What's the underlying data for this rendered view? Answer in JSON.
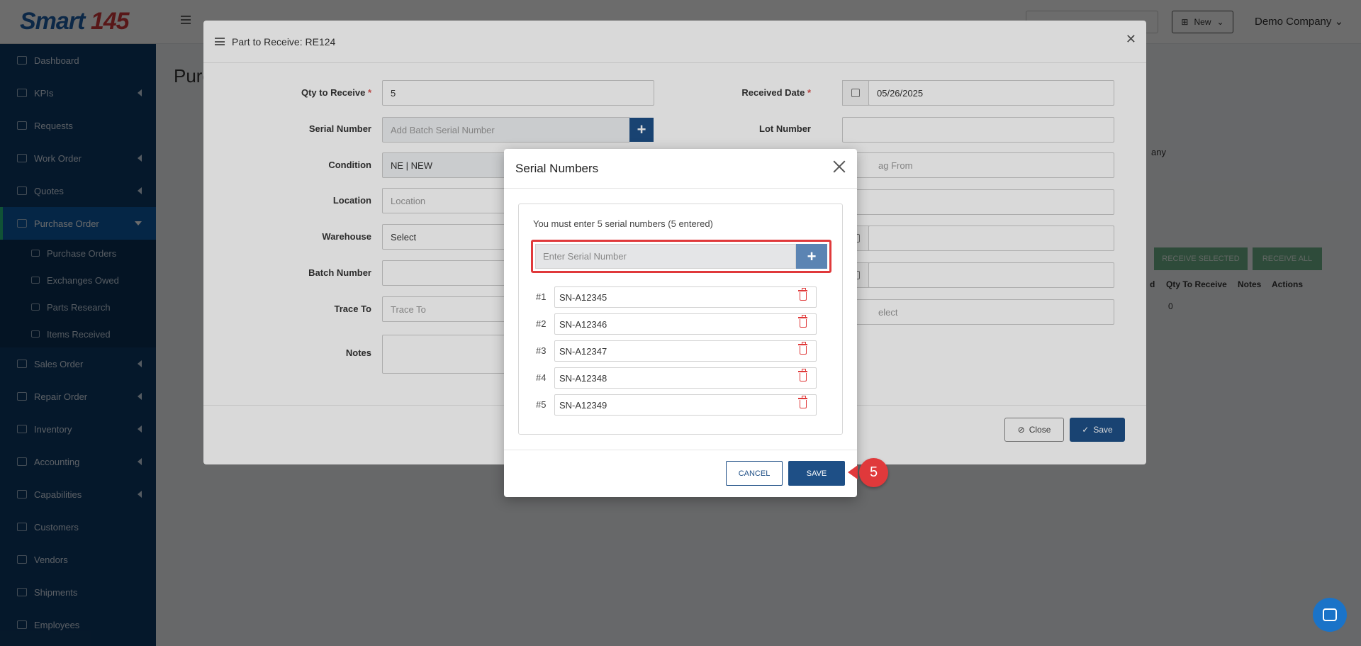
{
  "logo": {
    "text_main": "Smart ",
    "text_accent": "145"
  },
  "sidebar": {
    "items": [
      {
        "label": "Dashboard"
      },
      {
        "label": "KPIs"
      },
      {
        "label": "Requests"
      },
      {
        "label": "Work Order"
      },
      {
        "label": "Quotes"
      },
      {
        "label": "Purchase Order"
      },
      {
        "label": "Sales Order"
      },
      {
        "label": "Repair Order"
      },
      {
        "label": "Inventory"
      },
      {
        "label": "Accounting"
      },
      {
        "label": "Capabilities"
      },
      {
        "label": "Customers"
      },
      {
        "label": "Vendors"
      },
      {
        "label": "Shipments"
      },
      {
        "label": "Employees"
      }
    ],
    "sub_items": [
      {
        "label": "Purchase Orders"
      },
      {
        "label": "Exchanges Owed"
      },
      {
        "label": "Parts Research"
      },
      {
        "label": "Items Received"
      }
    ]
  },
  "topbar": {
    "new_label": "New",
    "company": "Demo Company"
  },
  "page": {
    "title": "Purc",
    "bg_fragment": "any"
  },
  "background_table": {
    "receive_selected": "RECEIVE SELECTED",
    "receive_all": "RECEIVE ALL",
    "headers": [
      "d",
      "Qty To Receive",
      "Notes",
      "Actions"
    ],
    "qty_value": "0"
  },
  "part_modal": {
    "title": "Part to Receive: RE124",
    "fields": {
      "qty_label": "Qty to Receive",
      "qty_value": "5",
      "serial_label": "Serial Number",
      "serial_placeholder": "Add Batch Serial Number",
      "condition_label": "Condition",
      "condition_value": "NE | NEW",
      "location_label": "Location",
      "location_placeholder": "Location",
      "warehouse_label": "Warehouse",
      "warehouse_value": "Select",
      "batch_label": "Batch Number",
      "trace_label": "Trace To",
      "trace_placeholder": "Trace To",
      "notes_label": "Notes",
      "received_date_label": "Received Date",
      "received_date_value": "05/26/2025",
      "lot_label": "Lot Number",
      "tag_from_fragment": "ag From",
      "select_fragment": "elect"
    },
    "close_label": "Close",
    "save_label": "Save"
  },
  "serial_modal": {
    "title": "Serial Numbers",
    "message": "You must enter 5 serial numbers (5 entered)",
    "entry_placeholder": "Enter Serial Number",
    "entries": [
      {
        "index": "#1",
        "value": "SN-A12345"
      },
      {
        "index": "#2",
        "value": "SN-A12346"
      },
      {
        "index": "#3",
        "value": "SN-A12347"
      },
      {
        "index": "#4",
        "value": "SN-A12348"
      },
      {
        "index": "#5",
        "value": "SN-A12349"
      }
    ],
    "cancel_label": "CANCEL",
    "save_label": "SAVE"
  },
  "callout": {
    "step": "5"
  },
  "colors": {
    "brand": "#1e4f86",
    "sidebar": "#0f3a66",
    "highlight": "#e0393b",
    "accent_green": "#26c281"
  }
}
